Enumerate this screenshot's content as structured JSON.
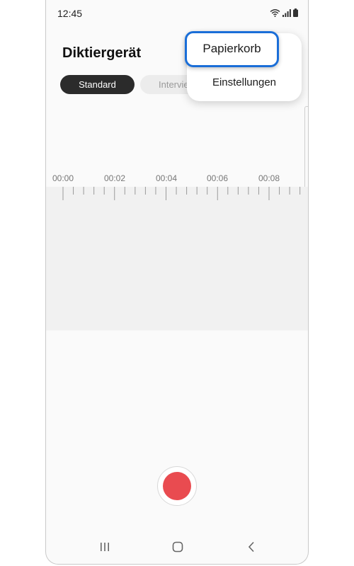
{
  "status_bar": {
    "time": "12:45",
    "icons": [
      "wifi-icon",
      "signal-icon",
      "battery-icon"
    ]
  },
  "app": {
    "title": "Diktiergerät"
  },
  "mode_tabs": [
    {
      "label": "Standard",
      "selected": true
    },
    {
      "label": "Intervie",
      "selected": false
    }
  ],
  "timeline": {
    "labels": [
      "00:00",
      "00:02",
      "00:04",
      "00:06",
      "00:08"
    ]
  },
  "record_button": {
    "icon": "record-icon",
    "color": "#e94b50"
  },
  "nav_bar": {
    "items": [
      "recent-apps-icon",
      "home-icon",
      "back-icon"
    ]
  },
  "overflow_menu": {
    "items": [
      {
        "label": "Papierkorb",
        "highlighted": true
      },
      {
        "label": "Einstellungen",
        "highlighted": false
      }
    ],
    "highlight_color": "#1a6ed8"
  }
}
